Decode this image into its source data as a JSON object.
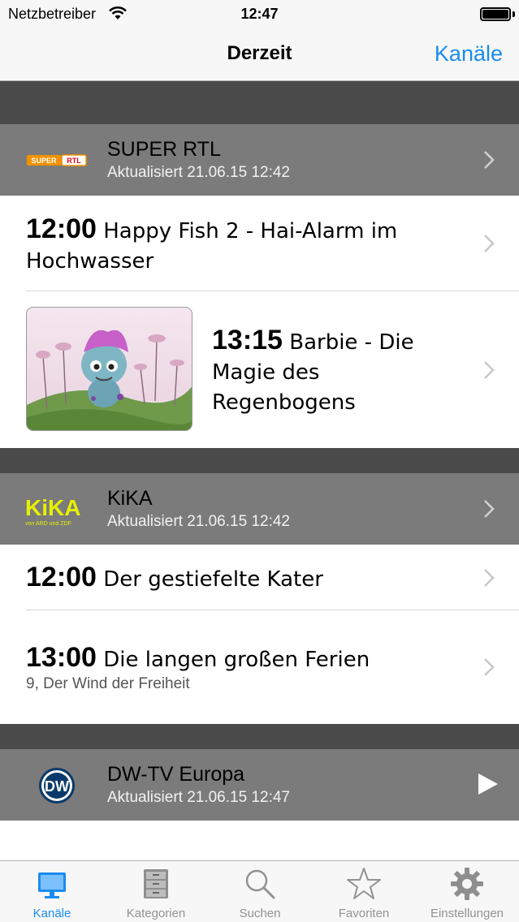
{
  "status_bar": {
    "carrier": "Netzbetreiber",
    "time": "12:47"
  },
  "nav": {
    "title": "Derzeit",
    "right_button": "Kanäle"
  },
  "channels": [
    {
      "name": "SUPER RTL",
      "updated": "Aktualisiert 21.06.15 12:42",
      "logo_text_1": "SUPER",
      "logo_text_2": "RTL",
      "programs": [
        {
          "time": "12:00",
          "title": "Happy Fish 2 - Hai-Alarm im Hochwasser"
        },
        {
          "time": "13:15",
          "title": "Barbie - Die Magie des Regenbogens"
        }
      ]
    },
    {
      "name": "KiKA",
      "updated": "Aktualisiert 21.06.15 12:42",
      "logo_text_1": "KiKA",
      "logo_text_2": "von ARD und ZDF",
      "programs": [
        {
          "time": "12:00",
          "title": "Der gestiefelte Kater"
        },
        {
          "time": "13:00",
          "title": "Die langen großen Ferien",
          "subtitle": "9, Der Wind der Freiheit"
        }
      ]
    },
    {
      "name": "DW-TV Europa",
      "updated": "Aktualisiert 21.06.15 12:47",
      "logo_text_1": "DW"
    }
  ],
  "tabs": [
    {
      "label": "Kanäle",
      "icon": "tv-icon",
      "active": true
    },
    {
      "label": "Kategorien",
      "icon": "cabinet-icon"
    },
    {
      "label": "Suchen",
      "icon": "search-icon"
    },
    {
      "label": "Favoriten",
      "icon": "star-icon"
    },
    {
      "label": "Einstellungen",
      "icon": "gear-icon"
    }
  ],
  "colors": {
    "accent": "#1a8cf0",
    "header_bg": "#7b7b7b",
    "spacer_bg": "#4b4b4b"
  }
}
